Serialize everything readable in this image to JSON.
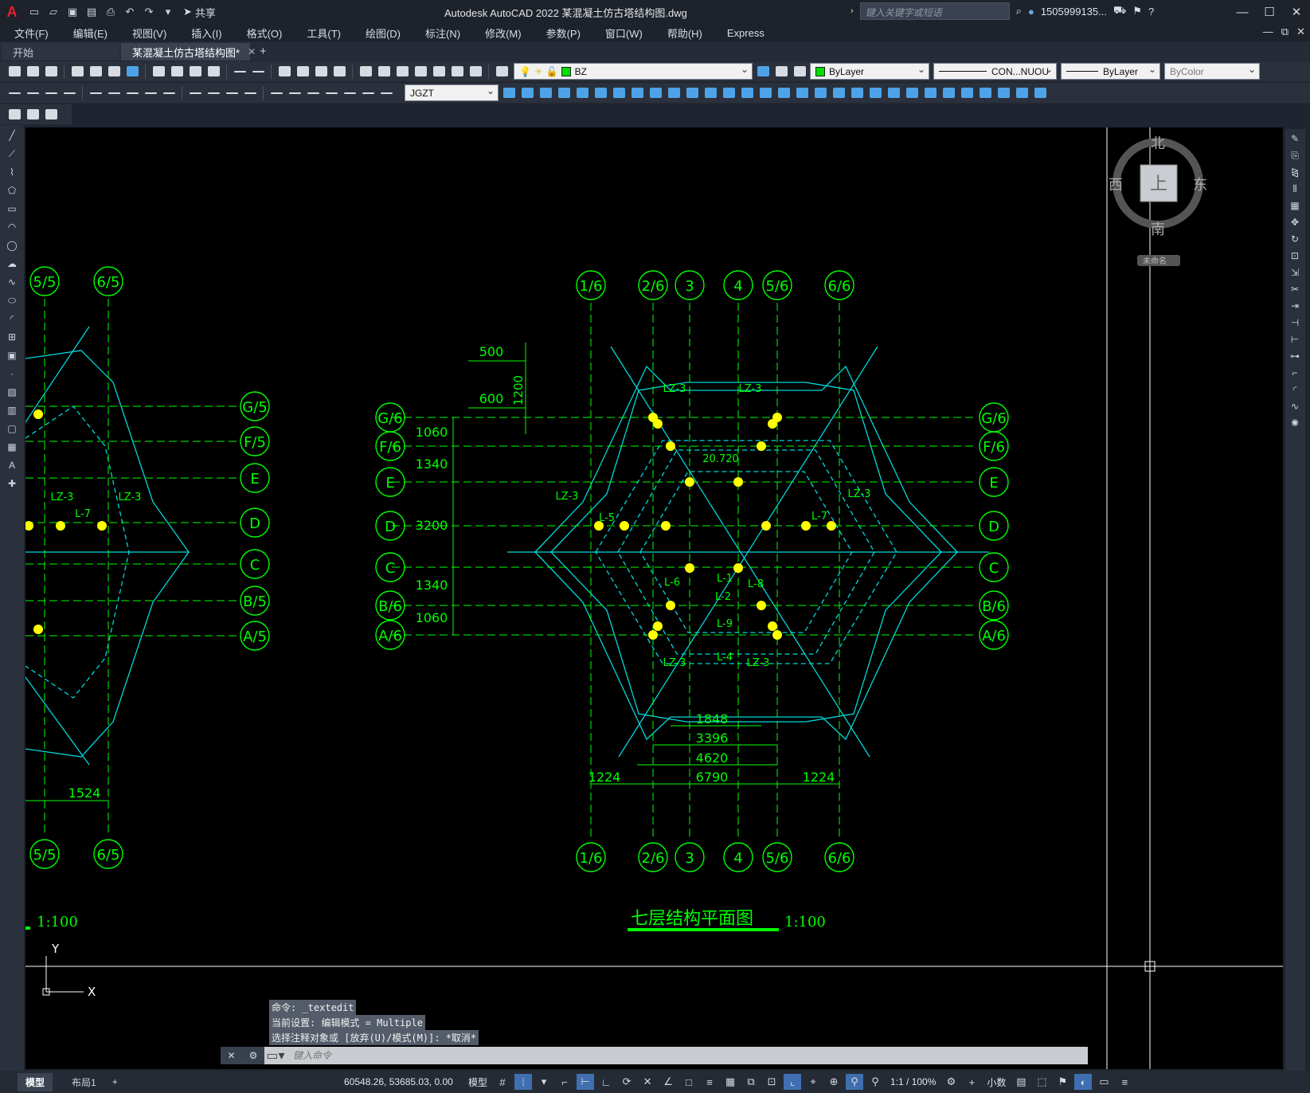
{
  "app": {
    "logo": "A",
    "title": "Autodesk AutoCAD 2022    某混凝土仿古塔结构图.dwg",
    "search_placeholder": "键入关键字或短语",
    "user": "1505999135...",
    "share_label": "共享"
  },
  "menu": [
    "文件(F)",
    "编辑(E)",
    "视图(V)",
    "插入(I)",
    "格式(O)",
    "工具(T)",
    "绘图(D)",
    "标注(N)",
    "修改(M)",
    "参数(P)",
    "窗口(W)",
    "帮助(H)",
    "Express"
  ],
  "tabs": [
    {
      "label": "开始",
      "active": false
    },
    {
      "label": "某混凝土仿古塔结构图*",
      "active": true
    }
  ],
  "toolbar": {
    "layer": "BZ",
    "color": "ByLayer",
    "linetype": "CON...NUOU",
    "lineweight": "ByLayer",
    "plotstyle": "ByColor",
    "textstyle": "JGZT"
  },
  "viewcube": {
    "north": "北",
    "south": "南",
    "east": "东",
    "west": "西",
    "top": "上",
    "ucs": "未命名"
  },
  "drawing": {
    "title": "七层结构平面图",
    "scale": "1:100",
    "scale_left": "1:100",
    "axis_top": [
      "1/6",
      "2/6",
      "3",
      "4",
      "5/6",
      "6/6"
    ],
    "axis_left": [
      "G/6",
      "F/6",
      "E",
      "D",
      "C",
      "B/6",
      "A/6"
    ],
    "axis_right": [
      "G/6",
      "F/6",
      "E",
      "D",
      "C",
      "B/6",
      "A/6"
    ],
    "left_axis_top": [
      "5/5",
      "6/5"
    ],
    "left_axis_right": [
      "G/5",
      "F/5",
      "E",
      "D",
      "C",
      "B/5",
      "A/5"
    ],
    "dims_vertical": [
      "1060",
      "1340",
      "3200",
      "1340",
      "1060"
    ],
    "dims_top": [
      "500",
      "600",
      "1200"
    ],
    "dims_bottom": [
      "1848",
      "3396",
      "4620",
      "6790",
      "1224",
      "1224"
    ],
    "left_dim": "1524",
    "elevation": "20.720",
    "beam_labels": [
      "LZ-3",
      "LZ-3",
      "LZ-3",
      "LZ-3",
      "LZ-3",
      "LZ-3",
      "L-5",
      "L-7",
      "L-1",
      "L-2",
      "L-9",
      "L-4",
      "L-6",
      "L-8",
      "LZ-3",
      "L-7",
      "LZ-3"
    ]
  },
  "command": {
    "history": [
      "命令: _textedit",
      "当前设置: 编辑模式 = Multiple",
      "选择注释对象或 [放弃(U)/模式(M)]: *取消*"
    ],
    "placeholder": "键入命令"
  },
  "status": {
    "layouts": [
      "模型",
      "布局1"
    ],
    "coords": "60548.26, 53685.03, 0.00",
    "mode": "模型",
    "scale": "1:1 / 100%",
    "units": "小数"
  },
  "colors": {
    "canvas": "#000000",
    "green": "#00ff00",
    "cyan": "#00d8d8",
    "yellow": "#ffff00"
  }
}
